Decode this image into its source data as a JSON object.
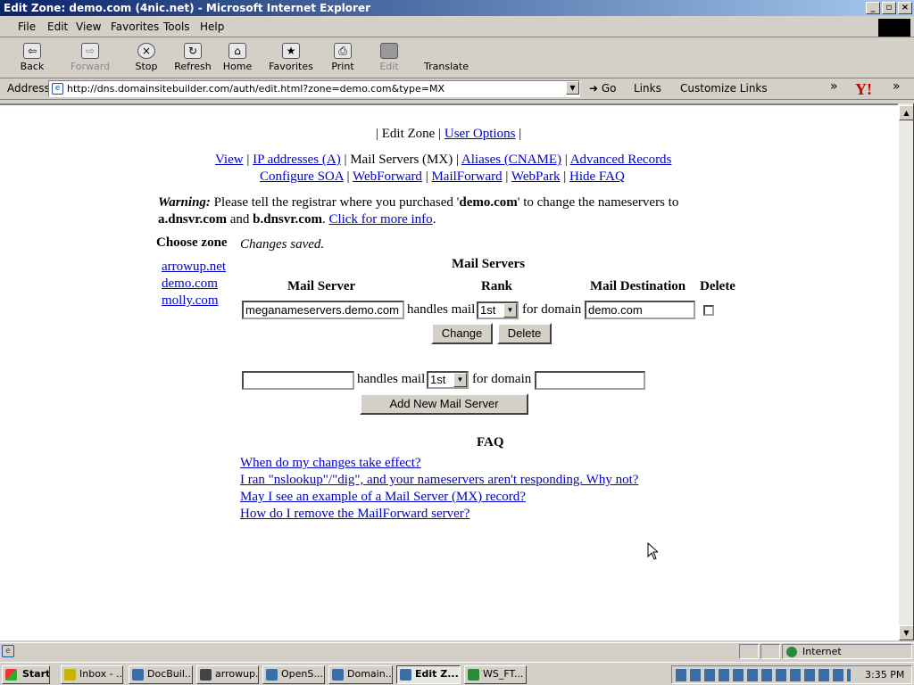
{
  "window": {
    "title": "Edit Zone: demo.com (4nic.net) - Microsoft Internet Explorer"
  },
  "menu": [
    "File",
    "Edit",
    "View",
    "Favorites",
    "Tools",
    "Help"
  ],
  "toolbar": {
    "back": "Back",
    "forward": "Forward",
    "stop": "Stop",
    "refresh": "Refresh",
    "home": "Home",
    "favorites": "Favorites",
    "print": "Print",
    "edit": "Edit",
    "translate": "Translate"
  },
  "addressbar": {
    "label": "Address",
    "url": "http://dns.domainsitebuilder.com/auth/edit.html?zone=demo.com&type=MX",
    "go": "Go",
    "links": "Links",
    "customize_links": "Customize Links",
    "chevron": "»"
  },
  "page": {
    "topnav": {
      "sep1": "|",
      "edit_zone": "Edit Zone",
      "sep2": "|",
      "user_options": "User Options",
      "sep3": "|"
    },
    "subnav": {
      "view": "View",
      "ip": "IP addresses (A)",
      "mail": "Mail Servers (MX)",
      "aliases": "Aliases (CNAME)",
      "advanced": "Advanced Records",
      "soa": "Configure SOA",
      "webforward": "WebForward",
      "mailforward": "MailForward",
      "webpark": "WebPark",
      "hidefaq": "Hide FAQ",
      "sep": "|"
    },
    "warning": {
      "label": "Warning:",
      "text1": "Please tell the registrar where you purchased '",
      "domain": "demo.com",
      "text2": "' to change the nameservers to",
      "ns1": "a.dnsvr.com",
      "and": "and",
      "ns2": "b.dnsvr.com",
      "period": ".",
      "more": "Click for more info"
    },
    "choose_zone": "Choose zone",
    "zones": [
      "arrowup.net",
      "demo.com",
      "molly.com"
    ],
    "status": "Changes saved.",
    "mail_servers": {
      "heading": "Mail Servers",
      "col_server": "Mail Server",
      "col_rank": "Rank",
      "col_destination": "Mail Destination",
      "col_delete": "Delete",
      "row": {
        "server": "meganameservers.demo.com",
        "handles": "handles mail",
        "rank": "1st",
        "for_domain": "for domain",
        "destination": "demo.com"
      },
      "change_button": "Change",
      "delete_button": "Delete",
      "new_row": {
        "server": "",
        "handles": "handles mail",
        "rank": "1st",
        "for_domain": "for domain",
        "destination": ""
      },
      "add_button": "Add New Mail Server"
    },
    "faq": {
      "heading": "FAQ",
      "items": [
        "When do my changes take effect?",
        "I ran \"nslookup\"/\"dig\", and your nameservers aren't responding. Why not?",
        "May I see an example of a Mail Server (MX) record?",
        "How do I remove the MailForward server?"
      ]
    }
  },
  "statusbar": {
    "zone": "Internet"
  },
  "taskbar": {
    "start": "Start",
    "tasks": [
      "Inbox - ...",
      "DocBuil...",
      "arrowup...",
      "OpenS...",
      "Domain...",
      "Edit Z...",
      "WS_FT..."
    ],
    "clock": "3:35 PM"
  }
}
